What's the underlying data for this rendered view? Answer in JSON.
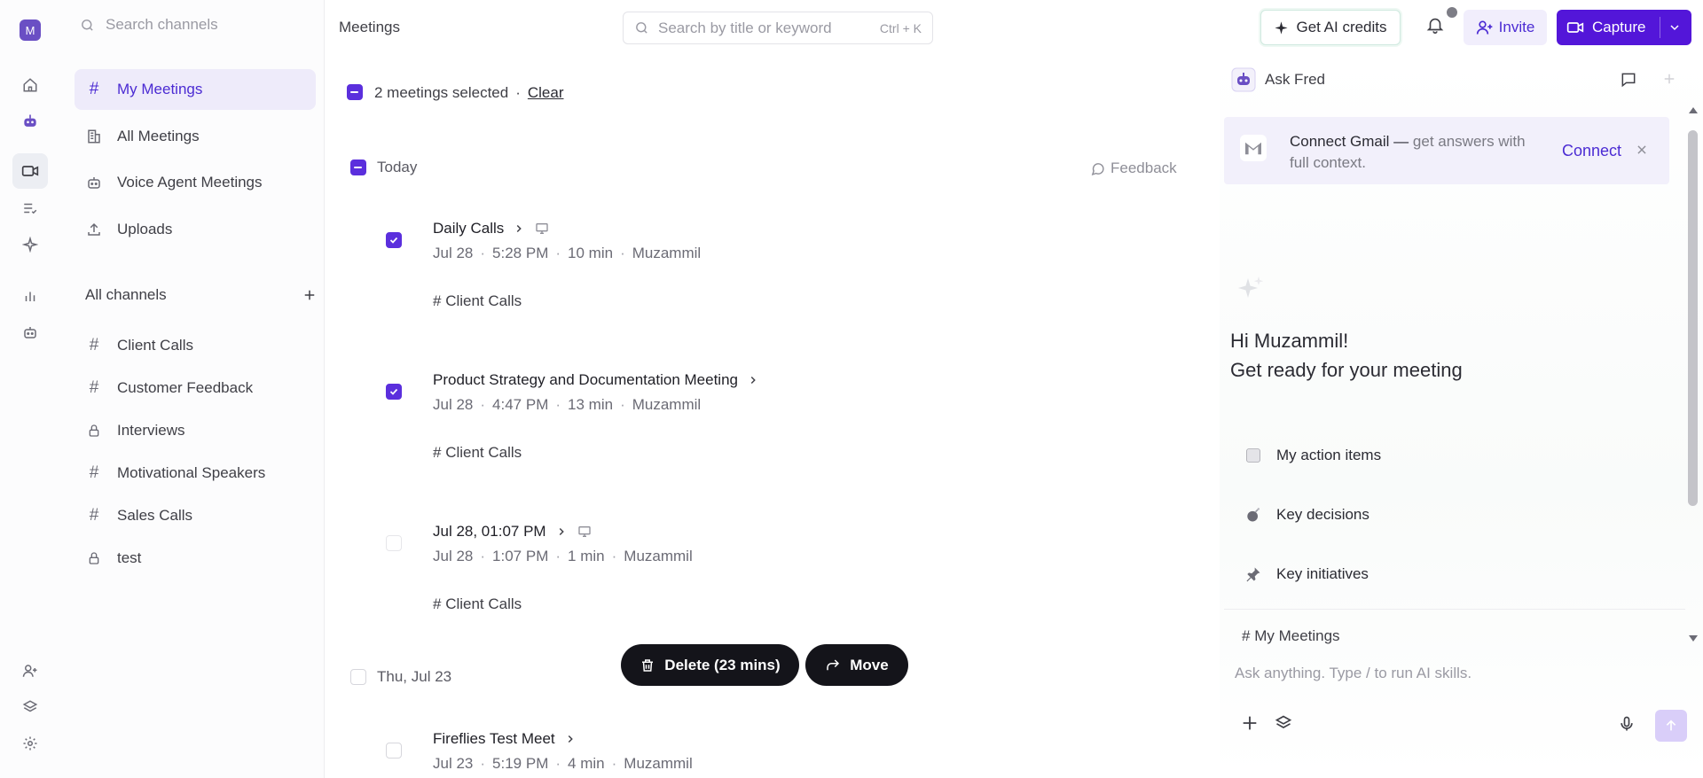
{
  "rail": {
    "workspace_initial": "M",
    "items": [
      "home-icon",
      "bot-icon",
      "video-icon",
      "tasks-icon",
      "sparkle-icon",
      "analytics-icon",
      "agent-icon",
      "add-user-icon",
      "layers-icon",
      "settings-icon"
    ]
  },
  "sidebar": {
    "search_placeholder": "Search channels",
    "nav": [
      {
        "label": "My Meetings",
        "icon": "hash-icon",
        "active": true
      },
      {
        "label": "All Meetings",
        "icon": "building-icon"
      },
      {
        "label": "Voice Agent Meetings",
        "icon": "bot-icon"
      },
      {
        "label": "Uploads",
        "icon": "upload-icon"
      }
    ],
    "channels_label": "All channels",
    "channels": [
      {
        "label": "Client Calls",
        "icon": "hash-icon"
      },
      {
        "label": "Customer Feedback",
        "icon": "hash-icon"
      },
      {
        "label": "Interviews",
        "icon": "lock-icon"
      },
      {
        "label": "Motivational Speakers",
        "icon": "hash-icon"
      },
      {
        "label": "Sales Calls",
        "icon": "hash-icon"
      },
      {
        "label": "test",
        "icon": "lock-icon"
      }
    ]
  },
  "topbar": {
    "breadcrumb": "Meetings",
    "search_placeholder": "Search by title or keyword",
    "search_shortcut": "Ctrl + K",
    "credits_label": "Get AI credits",
    "invite_label": "Invite",
    "capture_label": "Capture"
  },
  "selection": {
    "text": "2 meetings selected",
    "separator": "·",
    "clear_label": "Clear"
  },
  "groups": {
    "today_label": "Today",
    "feedback_label": "Feedback",
    "thu_label": "Thu, Jul 23"
  },
  "meetings": [
    {
      "title": "Daily Calls",
      "date": "Jul 28",
      "time": "5:28 PM",
      "duration": "10 min",
      "owner": "Muzammil",
      "channel": "Client Calls",
      "checked": true
    },
    {
      "title": "Product Strategy and Documentation Meeting",
      "date": "Jul 28",
      "time": "4:47 PM",
      "duration": "13 min",
      "owner": "Muzammil",
      "channel": "Client Calls",
      "checked": true
    },
    {
      "title": "Jul 28, 01:07 PM",
      "date": "Jul 28",
      "time": "1:07 PM",
      "duration": "1 min",
      "owner": "Muzammil",
      "channel": "Client Calls",
      "checked": false
    },
    {
      "title": "Fireflies Test Meet",
      "date": "Jul 23",
      "time": "5:19 PM",
      "duration": "4 min",
      "owner": "Muzammil",
      "checked": false
    }
  ],
  "actions": {
    "delete_label": "Delete (23 mins)",
    "move_label": "Move"
  },
  "panel": {
    "title": "Ask Fred",
    "gmail_title": "Connect Gmail —",
    "gmail_desc": "get answers with full context.",
    "gmail_connect": "Connect",
    "greeting_line1": "Hi Muzammil!",
    "greeting_line2": "Get ready for your meeting",
    "suggestions": [
      {
        "label": "My action items",
        "icon": "checklist-icon"
      },
      {
        "label": "Key decisions",
        "icon": "bomb-icon"
      },
      {
        "label": "Key initiatives",
        "icon": "pin-icon"
      }
    ],
    "composer_channel": "My Meetings",
    "composer_placeholder": "Ask anything. Type / to run AI skills."
  },
  "colors": {
    "accent": "#5316d9",
    "checkbox": "#5b2fdd",
    "pill_bg": "#14141a"
  }
}
